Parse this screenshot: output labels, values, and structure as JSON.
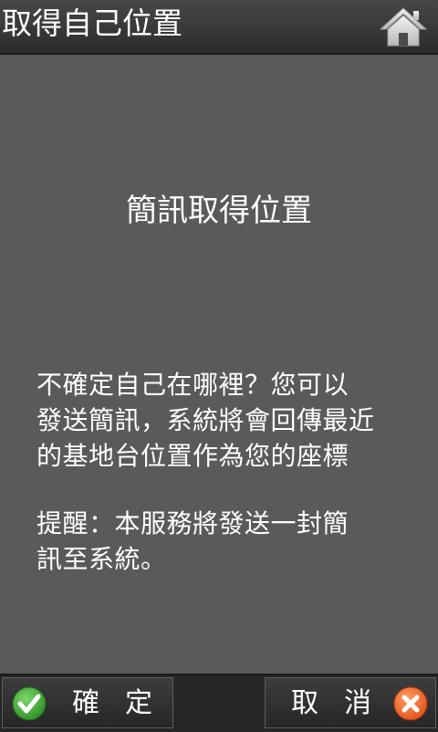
{
  "header": {
    "title": "取得自己位置",
    "home_icon": "home-icon"
  },
  "main": {
    "heading": "簡訊取得位置",
    "message_lines": [
      "不確定自己在哪裡？您可以",
      "發送簡訊，系統將會回傳最近",
      "的基地台位置作為您的座標"
    ],
    "reminder_lines": [
      "提醒：本服務將發送一封簡",
      "訊至系統。"
    ]
  },
  "footer": {
    "ok_label": "確定",
    "ok_icon": "check-icon",
    "cancel_label": "取消",
    "cancel_icon": "close-icon"
  },
  "colors": {
    "background": "#5a5a5a",
    "confirm_green": "#3aa830",
    "cancel_orange": "#f0641e"
  }
}
